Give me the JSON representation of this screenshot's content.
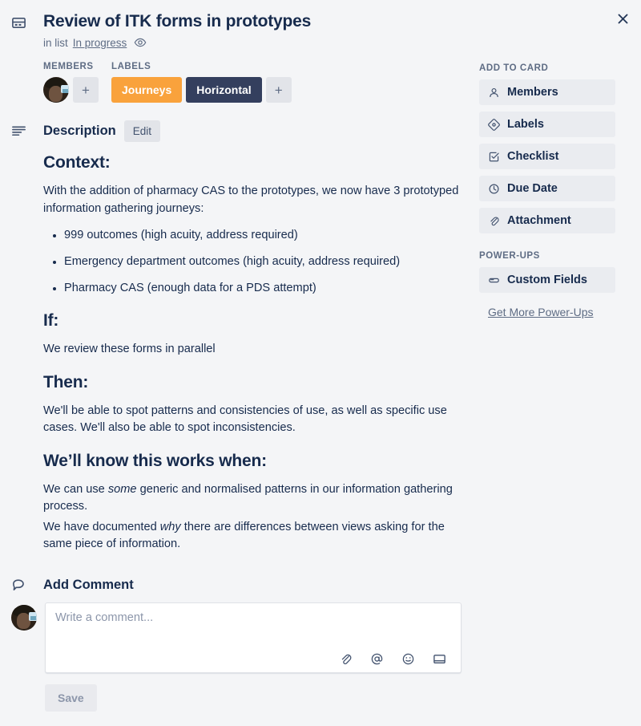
{
  "header": {
    "card_icon": "card-icon",
    "title": "Review of ITK forms in prototypes",
    "in_list_prefix": "in list",
    "list_name": "In progress",
    "watch_icon": "eye-icon",
    "close_icon": "close-icon"
  },
  "meta": {
    "members_heading": "MEMBERS",
    "labels_heading": "LABELS",
    "add_member_label": "+",
    "add_label_label": "+",
    "labels": [
      {
        "text": "Journeys",
        "color": "#F9A23C"
      },
      {
        "text": "Horizontal",
        "color": "#343F5E"
      }
    ]
  },
  "description": {
    "icon": "description-lines-icon",
    "title": "Description",
    "edit_label": "Edit",
    "h_context": "Context:",
    "p_context": "With the addition of pharmacy CAS to the prototypes, we now have 3 prototyped information gathering journeys:",
    "bullets": [
      "999 outcomes (high acuity, address required)",
      "Emergency department outcomes (high acuity, address required)",
      "Pharmacy CAS (enough data for a PDS attempt)"
    ],
    "h_if": "If:",
    "p_if": "We review these forms in parallel",
    "h_then": "Then:",
    "p_then": "We'll be able to spot patterns and consistencies of use, as well as specific use cases. We'll also be able to spot inconsistencies.",
    "h_know": "We’ll know this works when:",
    "p_know_1_a": "We can use ",
    "p_know_1_em": "some",
    "p_know_1_b": " generic and normalised patterns in our information gathering process.",
    "p_know_2_a": "We have documented ",
    "p_know_2_em": "why",
    "p_know_2_b": " there are differences between views asking for the same piece of information."
  },
  "comment": {
    "icon": "comment-bubble-icon",
    "title": "Add Comment",
    "placeholder": "Write a comment...",
    "save_label": "Save",
    "tools": [
      {
        "name": "attachment-icon"
      },
      {
        "name": "mention-icon"
      },
      {
        "name": "emoji-icon"
      },
      {
        "name": "card-template-icon"
      }
    ]
  },
  "sidebar": {
    "add_to_card_heading": "ADD TO CARD",
    "add_items": [
      {
        "label": "Members",
        "icon": "person-icon"
      },
      {
        "label": "Labels",
        "icon": "label-tag-icon"
      },
      {
        "label": "Checklist",
        "icon": "checklist-icon"
      },
      {
        "label": "Due Date",
        "icon": "clock-icon"
      },
      {
        "label": "Attachment",
        "icon": "paperclip-icon"
      }
    ],
    "powerups_heading": "POWER-UPS",
    "powerup_items": [
      {
        "label": "Custom Fields",
        "icon": "custom-fields-icon"
      }
    ],
    "get_more_label": "Get More Power-Ups"
  }
}
